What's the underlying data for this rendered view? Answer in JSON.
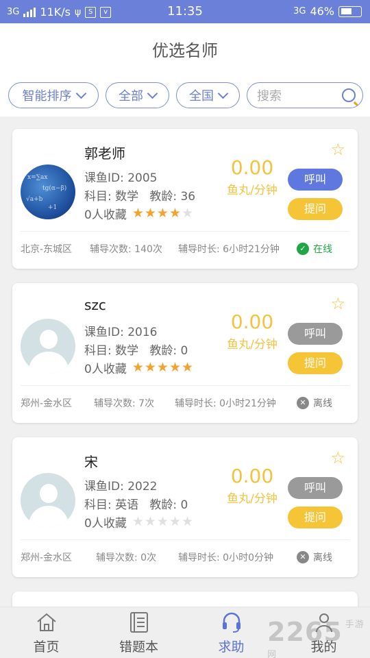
{
  "status_bar": {
    "network": "3G",
    "speed": "11K/s",
    "time": "11:35",
    "network_right": "3G",
    "battery": "46%"
  },
  "header": {
    "title": "优选名师"
  },
  "filters": {
    "sort": "智能排序",
    "subject": "全部",
    "region": "全国",
    "search_placeholder": "搜索"
  },
  "teachers": [
    {
      "name": "郭老师",
      "id_text": "课鱼ID: 2005",
      "subject_text": "科目: 数学",
      "age_text": "教龄: 36",
      "fav_text": "0人收藏",
      "rating": 4,
      "price": "0.00",
      "unit": "鱼丸/分钟",
      "call": "呼叫",
      "ask": "提问",
      "location": "北京-东城区",
      "sessions": "辅导次数: 140次",
      "duration": "辅导时长: 6小时21分钟",
      "status": "在线",
      "online": true,
      "photo": true
    },
    {
      "name": "szc",
      "id_text": "课鱼ID: 2016",
      "subject_text": "科目: 数学",
      "age_text": "教龄: 0",
      "fav_text": "0人收藏",
      "rating": 5,
      "price": "0.00",
      "unit": "鱼丸/分钟",
      "call": "呼叫",
      "ask": "提问",
      "location": "郑州-金水区",
      "sessions": "辅导次数: 7次",
      "duration": "辅导时长: 0小时21分钟",
      "status": "离线",
      "online": false,
      "photo": false
    },
    {
      "name": "宋",
      "id_text": "课鱼ID: 2022",
      "subject_text": "科目: 英语",
      "age_text": "教龄: 0",
      "fav_text": "0人收藏",
      "rating": 0,
      "price": "0.00",
      "unit": "鱼丸/分钟",
      "call": "呼叫",
      "ask": "提问",
      "location": "郑州-金水区",
      "sessions": "辅导次数: 0次",
      "duration": "辅导时长: 0小时0分钟",
      "status": "离线",
      "online": false,
      "photo": false
    }
  ],
  "nav": [
    {
      "label": "首页",
      "icon": "home-icon"
    },
    {
      "label": "错题本",
      "icon": "notebook-icon"
    },
    {
      "label": "求助",
      "icon": "headset-icon",
      "active": true
    },
    {
      "label": "我的",
      "icon": "profile-icon"
    }
  ],
  "watermark": {
    "text": "2265",
    "sub": "手游网"
  },
  "colors": {
    "primary": "#6b80d8",
    "accent": "#f5c437",
    "online": "#22a545"
  }
}
